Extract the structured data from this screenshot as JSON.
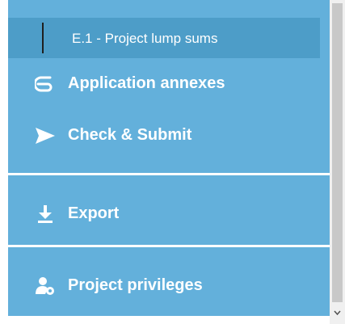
{
  "sidebar": {
    "active_sub_item": {
      "label": "E.1 - Project lump sums"
    },
    "items": [
      {
        "label": "Application annexes",
        "icon": "paperclip-icon"
      },
      {
        "label": "Check & Submit",
        "icon": "send-arrow-icon"
      },
      {
        "label": "Export",
        "icon": "download-icon"
      },
      {
        "label": "Project privileges",
        "icon": "user-gear-icon"
      }
    ]
  },
  "colors": {
    "sidebar_background": "#63b0db",
    "active_sub_item_background": "#4d9dc8",
    "text": "#ffffff",
    "divider": "#ffffff"
  }
}
